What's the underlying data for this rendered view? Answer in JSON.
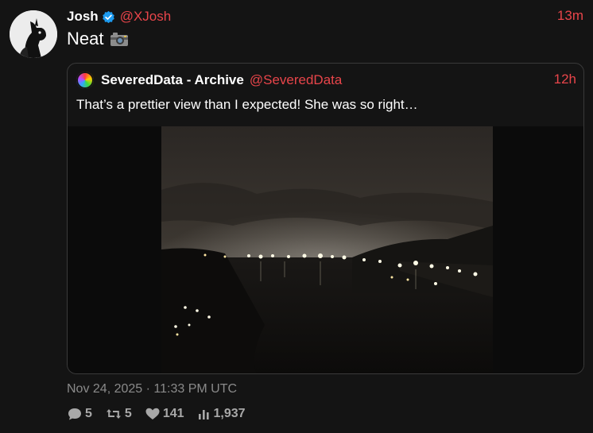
{
  "post": {
    "author_name": "Josh",
    "author_handle": "@XJosh",
    "time": "13m",
    "text": "Neat",
    "avatar_icon": "horse-mask-avatar-icon",
    "verified_icon": "verified-badge-icon",
    "emoji_icon": "camera-icon",
    "timestamp": "Nov 24, 2025 · 11:33 PM UTC"
  },
  "quote": {
    "author_name": "SeveredData - Archive",
    "author_handle": "@SeveredData",
    "time": "12h",
    "text": "That’s a prettier view than I expected! She was so right…",
    "avatar_icon": "rainbow-avatar-icon",
    "media_alt": "night-harbor-photo"
  },
  "stats": {
    "replies": "5",
    "retweets": "5",
    "likes": "141",
    "views": "1,937"
  },
  "colors": {
    "background": "#141414",
    "accent": "#e8454a",
    "muted": "#8a8a8a",
    "verified": "#1d9bf0",
    "border": "#3a3a3a"
  }
}
